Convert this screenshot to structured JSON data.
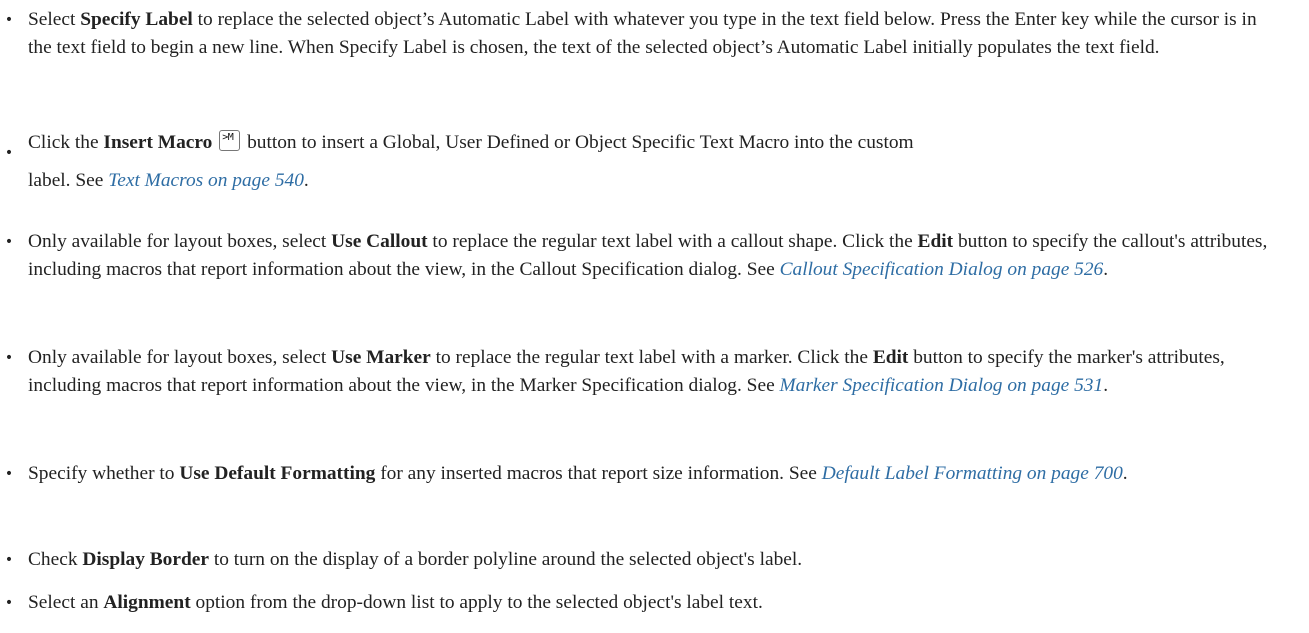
{
  "bullets": [
    {
      "pre": "Select ",
      "bold": "Specify Label",
      "post": " to replace the selected object’s Automatic Label with whatever you type in the text field below. Press the Enter key while the cursor is in the text field to begin a new line. When Specify Label is chosen, the text of the selected object’s Automatic Label initially populates the text field."
    },
    {
      "pre": "Click the ",
      "bold": "Insert Macro",
      "icon_text": ">M",
      "icon_name": "insert-macro-icon",
      "post": " button to insert a Global, User Defined or Object Specific Text Macro into the custom",
      "line2_pre": "label. See ",
      "link": "Text Macros on page 540",
      "line2_post": "."
    },
    {
      "pre": "Only available for layout boxes, select ",
      "bold": "Use Callout",
      "mid": " to replace the regular text label with a callout shape. Click the ",
      "bold2": "Edit",
      "post": " button to specify the callout's attributes, including macros that report information about the view, in the Callout Specification dialog. See ",
      "link": "Callout Specification Dialog on page 526",
      "end": "."
    },
    {
      "pre": "Only available for layout boxes, select ",
      "bold": "Use Marker",
      "mid": " to replace the regular text label with a marker. Click the ",
      "bold2": "Edit",
      "post": " button to specify the marker's attributes, including macros that report information about the view, in the Marker Specification dialog. See ",
      "link": "Marker Specification Dialog on page 531",
      "end": "."
    },
    {
      "pre": "Specify whether to ",
      "bold": "Use Default Formatting",
      "post": " for any inserted macros that report size information. See ",
      "link": "Default Label Formatting on page 700",
      "end": "."
    },
    {
      "pre": "Check ",
      "bold": "Display Border",
      "post": " to turn on the display of a border polyline around the selected object's label."
    },
    {
      "pre": "Select an ",
      "bold": "Alignment",
      "post": " option from the drop-down list to apply to the selected object's label text."
    }
  ],
  "bullet_glyph": "•",
  "colors": {
    "text": "#222222",
    "link": "#2e6da4"
  }
}
